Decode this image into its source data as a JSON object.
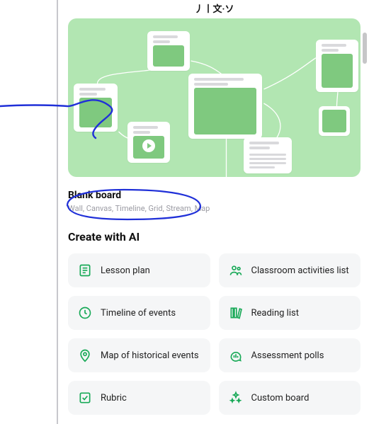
{
  "header_fragment": "丿丨文·ソ",
  "hero": {
    "alt": "Illustration of connected Padlet cards on a green canvas"
  },
  "blank_board": {
    "title": "Blank board",
    "subtitle": "Wall, Canvas, Timeline, Grid, Stream, Map"
  },
  "create_with_ai": {
    "title": "Create with AI",
    "options": [
      {
        "icon": "document-list-icon",
        "label": "Lesson plan"
      },
      {
        "icon": "people-icon",
        "label": "Classroom activities list"
      },
      {
        "icon": "clock-icon",
        "label": "Timeline of events"
      },
      {
        "icon": "books-icon",
        "label": "Reading list"
      },
      {
        "icon": "map-pin-icon",
        "label": "Map of historical events"
      },
      {
        "icon": "poll-icon",
        "label": "Assessment polls"
      },
      {
        "icon": "checkbox-icon",
        "label": "Rubric"
      },
      {
        "icon": "sparkles-icon",
        "label": "Custom board"
      }
    ]
  },
  "colors": {
    "accent": "#18a957"
  }
}
